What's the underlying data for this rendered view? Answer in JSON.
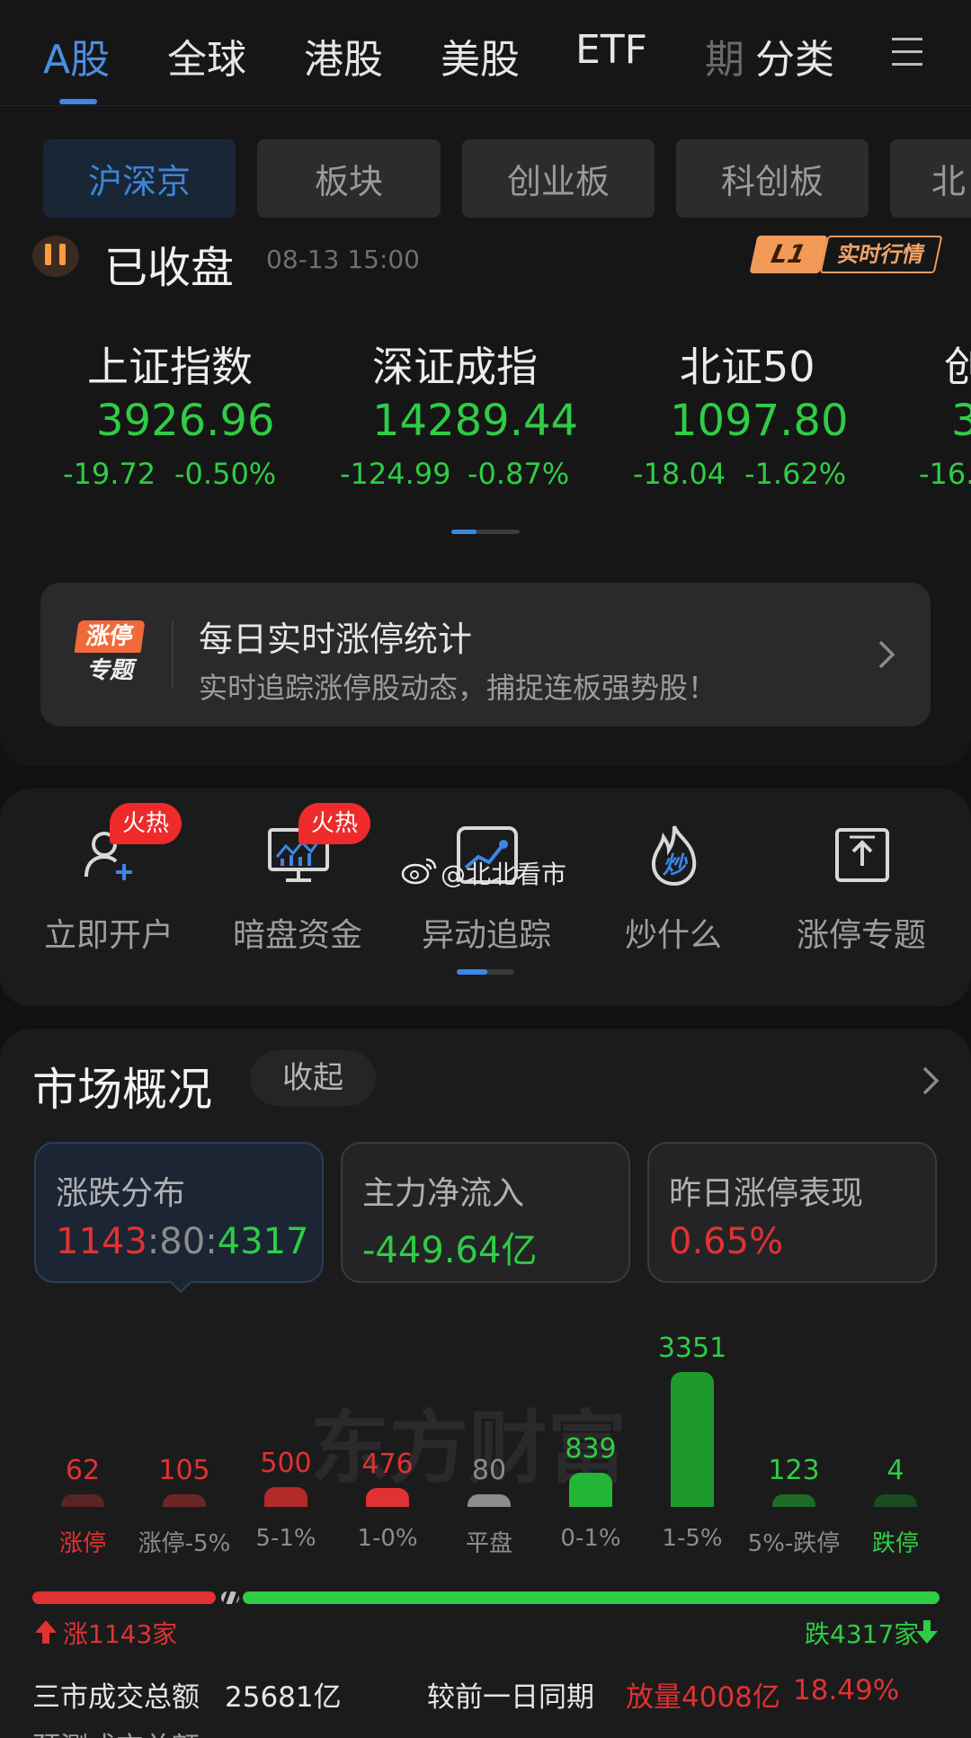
{
  "top_tabs": [
    "A股",
    "全球",
    "港股",
    "美股",
    "ETF",
    "期",
    "分类"
  ],
  "chips": [
    "沪深京",
    "板块",
    "创业板",
    "科创板",
    "北"
  ],
  "status": {
    "title": "已收盘",
    "time": "08-13  15:00",
    "badge_l1": "L1",
    "badge_text": "实时行情"
  },
  "indices": [
    {
      "name": "上证指数",
      "value": "3926.96",
      "change": "-19.72",
      "pct": "-0.50%"
    },
    {
      "name": "深证成指",
      "value": "14289.44",
      "change": "-124.99",
      "pct": "-0.87%"
    },
    {
      "name": "北证50",
      "value": "1097.80",
      "change": "-18.04",
      "pct": "-1.62%"
    },
    {
      "name": "创",
      "value": "3",
      "change": "-16.",
      "pct": ""
    }
  ],
  "banner": {
    "logo_top": "涨停",
    "logo_bottom": "专题",
    "title": "每日实时涨停统计",
    "subtitle": "实时追踪涨停股动态，捕捉连板强势股！"
  },
  "shortcuts": [
    {
      "label": "立即开户",
      "badge": "火热"
    },
    {
      "label": "暗盘资金",
      "badge": "火热"
    },
    {
      "label": "异动追踪",
      "badge": ""
    },
    {
      "label": "炒什么",
      "badge": "",
      "icon_text": "炒"
    },
    {
      "label": "涨停专题",
      "badge": ""
    }
  ],
  "watermark": "@北北看市",
  "market": {
    "title": "市场概况",
    "collapse": "收起",
    "cards": [
      {
        "label": "涨跌分布",
        "up": "1143",
        "sep1": ":",
        "flat": "80",
        "sep2": ":",
        "down": "4317"
      },
      {
        "label": "主力净流入",
        "value": "-449.64亿"
      },
      {
        "label": "昨日涨停表现",
        "value": "0.65%"
      }
    ],
    "chart_watermark": "东方财富",
    "up_total": "涨1143家",
    "down_total": "跌4317家",
    "summary": {
      "turnover_label": "三市成交总额",
      "turnover_value": "25681亿",
      "compare_label": "较前一日同期",
      "compare_value": "放量4008亿",
      "compare_pct": "18.49%",
      "forecast_label": "预测成交总额"
    }
  },
  "colors": {
    "up": "#e03232",
    "down": "#2fcc45",
    "flat": "#8c8c8e",
    "accent": "#3d86e6"
  },
  "chart_data": {
    "type": "bar",
    "categories": [
      "涨停",
      "涨停-5%",
      "5-1%",
      "1-0%",
      "平盘",
      "0-1%",
      "1-5%",
      "5%-跌停",
      "跌停"
    ],
    "values": [
      62,
      105,
      500,
      476,
      80,
      839,
      3351,
      123,
      4
    ],
    "value_labels": [
      "62",
      "105",
      "500",
      "476",
      "80",
      "839",
      "3351",
      "123",
      "4"
    ]
  }
}
